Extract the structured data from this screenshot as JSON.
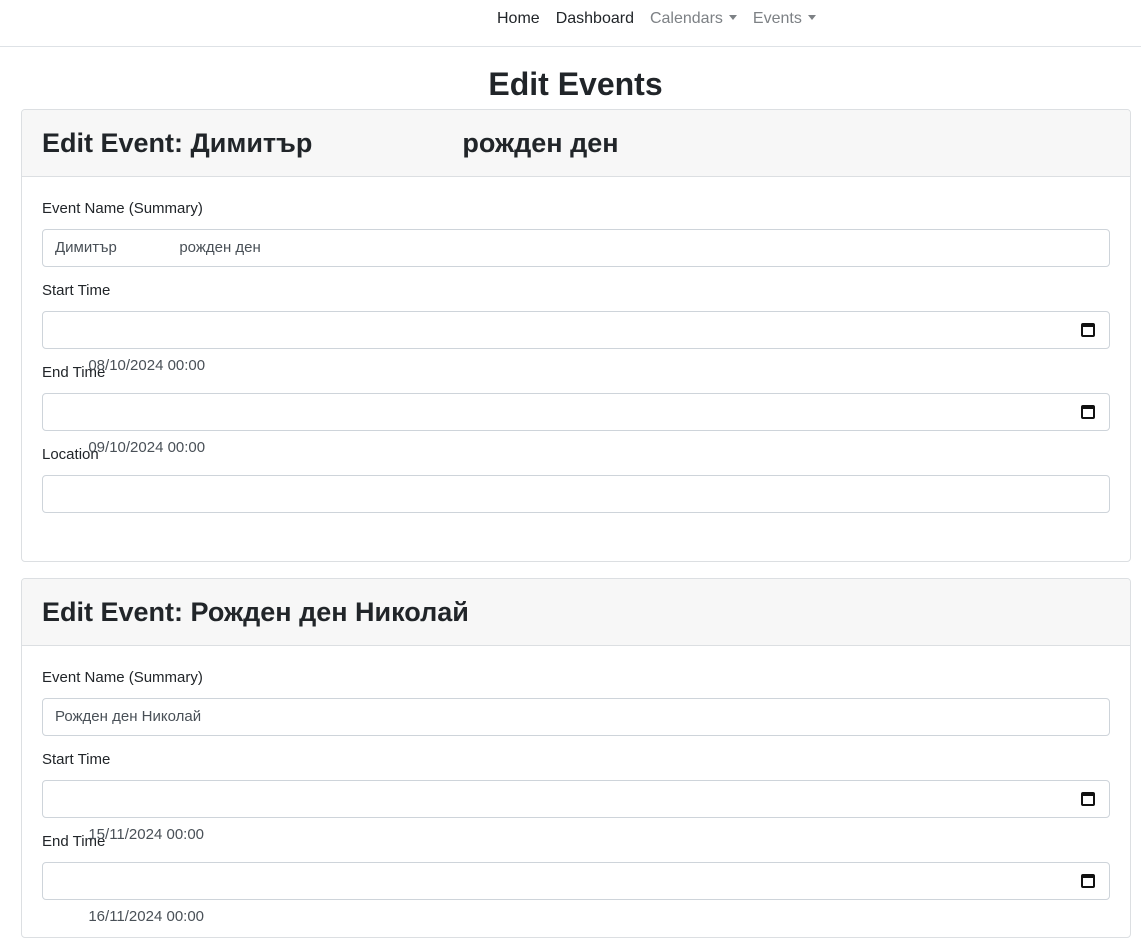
{
  "nav": {
    "items": [
      {
        "label": "Home"
      },
      {
        "label": "Dashboard"
      },
      {
        "label": "Calendars"
      },
      {
        "label": "Events"
      }
    ]
  },
  "page": {
    "title": "Edit Events"
  },
  "events": [
    {
      "header": "Edit Event: Димитър                    рожден ден",
      "summary_label": "Event Name (Summary)",
      "summary_value": "Димитър               рожден ден",
      "start_label": "Start Time",
      "start_value": "08/10/2024 00:00",
      "end_label": "End Time",
      "end_value": "09/10/2024 00:00",
      "location_label": "Location",
      "location_value": ""
    },
    {
      "header": "Edit Event: Рожден ден Николай",
      "summary_label": "Event Name (Summary)",
      "summary_value": "Рожден ден Николай",
      "start_label": "Start Time",
      "start_value": "15/11/2024 00:00",
      "end_label": "End Time",
      "end_value": "16/11/2024 00:00"
    }
  ],
  "icons": {
    "datetime_picker": "calendar-icon",
    "dropdown": "caret-down-icon"
  }
}
